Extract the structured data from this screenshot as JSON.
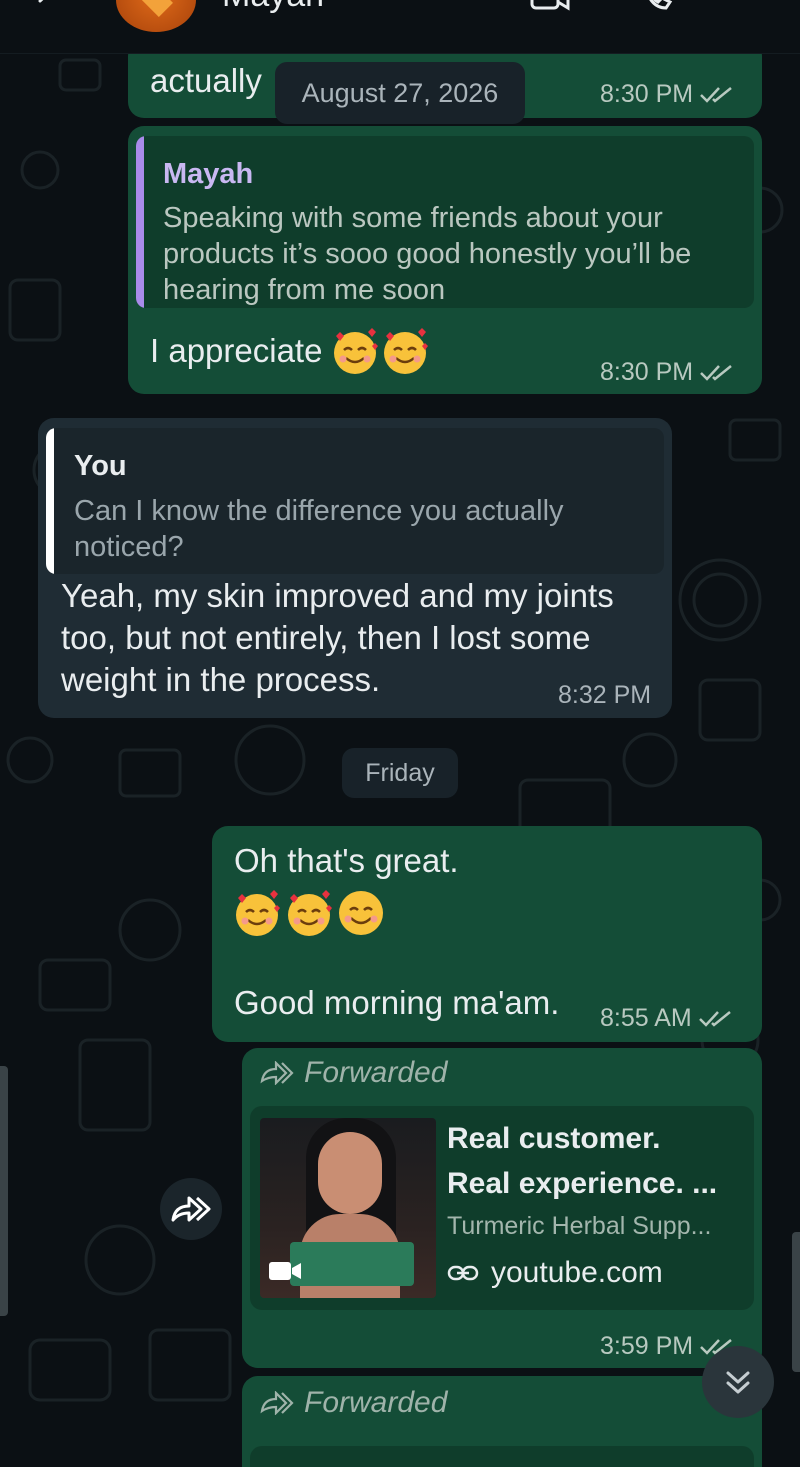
{
  "header": {
    "contact_name": "Mayah"
  },
  "messages": {
    "m0": {
      "text_tail": "actually",
      "time": "8:30 PM"
    },
    "date_overlay": "August 27, 2026",
    "m1": {
      "quote_author": "Mayah",
      "quote_text": "Speaking with some friends about your products it’s sooo good honestly you’ll be hearing from me soon",
      "text": "I appreciate",
      "time": "8:30 PM"
    },
    "m2": {
      "quote_author": "You",
      "quote_text": "Can I know the difference you actually noticed?",
      "text": "Yeah, my skin improved and my joints too, but not entirely, then I lost some weight in the process.",
      "time": "8:32 PM"
    },
    "day_divider": "Friday",
    "m3": {
      "line1": "Oh that's great.",
      "line3": "Good morning ma'am.",
      "time": "8:55 AM"
    },
    "m4": {
      "forwarded_label": "Forwarded",
      "link_title_1": "Real customer.",
      "link_title_2": "Real experience. ...",
      "link_desc": "Turmeric Herbal Supp...",
      "link_host": "youtube.com",
      "time": "3:59 PM"
    },
    "m5": {
      "forwarded_label": "Forwarded"
    }
  },
  "colors": {
    "background": "#0b1014",
    "outgoing_bubble": "#144d37",
    "incoming_bubble": "#1f2c34",
    "read_ticks": "#b8c9c0",
    "quote_bar_mayah": "#a98bea",
    "quote_bar_you": "#ffffff"
  },
  "icons": [
    "back-arrow-icon",
    "video-call-icon",
    "voice-call-icon",
    "more-options-icon",
    "double-check-icon",
    "forward-icon",
    "share-icon",
    "link-icon",
    "video-camera-icon",
    "scroll-down-icon",
    "smiling-face-with-hearts-emoji",
    "smiling-face-emoji"
  ]
}
